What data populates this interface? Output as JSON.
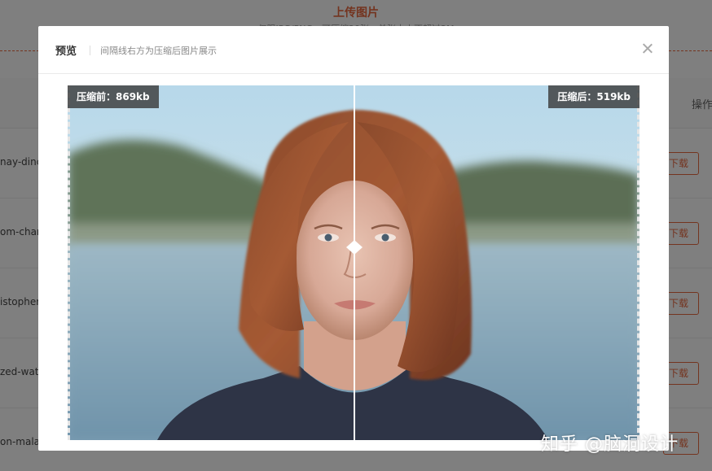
{
  "background": {
    "title": "上传图片",
    "subtitle": "仅限JPG/PNG，可压缩20张，单张大小不超过2M",
    "ops_header": "操作",
    "rows": [
      {
        "name": "nay-dinc",
        "download": "下载"
      },
      {
        "name": "om-chan",
        "download": "下载"
      },
      {
        "name": "istopher",
        "download": "下载"
      },
      {
        "name": "zed-wate",
        "download": "下载"
      },
      {
        "name": "on-mala",
        "download": "下载"
      }
    ]
  },
  "modal": {
    "title": "预览",
    "description": "间隔线右方为压缩后图片展示",
    "close_label": "×"
  },
  "compare": {
    "before_label": "压缩前：869kb",
    "after_label": "压缩后：519kb",
    "image_description": "Portrait of a young woman with auburn bob hair, lake and hills in background",
    "divider_position_fraction": 0.5
  },
  "watermark": "知乎 @脑洞设计",
  "colors": {
    "accent": "#e8683f",
    "overlay": "rgba(0,0,0,0.5)",
    "label_bg": "#3c3c3c"
  }
}
